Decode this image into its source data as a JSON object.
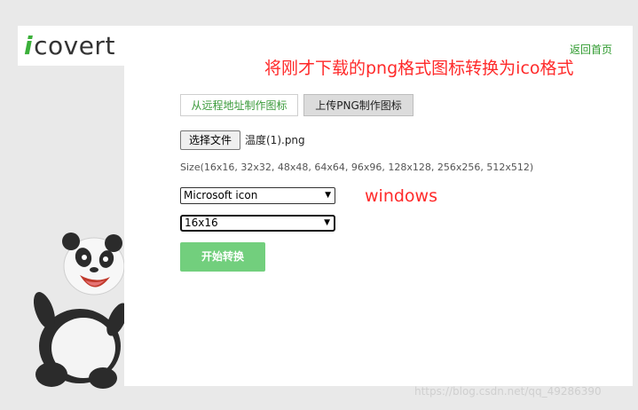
{
  "logo": {
    "initial": "i",
    "rest": "covert"
  },
  "header": {
    "back_link": "返回首页"
  },
  "annotations": {
    "title": "将刚才下载的png格式图标转换为ico格式",
    "windows": "windows"
  },
  "tabs": [
    {
      "label": "从远程地址制作图标",
      "active": true
    },
    {
      "label": "上传PNG制作图标",
      "active": false
    }
  ],
  "file": {
    "button_label": "选择文件",
    "file_name": "温度(1).png"
  },
  "size_hint": "Size(16x16, 32x32, 48x48, 64x64, 96x96, 128x128, 256x256, 512x512)",
  "format_select": {
    "value": "Microsoft icon"
  },
  "size_select": {
    "value": "16x16"
  },
  "start_button": {
    "label": "开始转换"
  },
  "watermark": "https://blog.csdn.net/qq_49286390",
  "colors": {
    "accent_green": "#3bb03a",
    "button_green": "#72cf7d",
    "annotation_red": "#ff2a2a"
  }
}
